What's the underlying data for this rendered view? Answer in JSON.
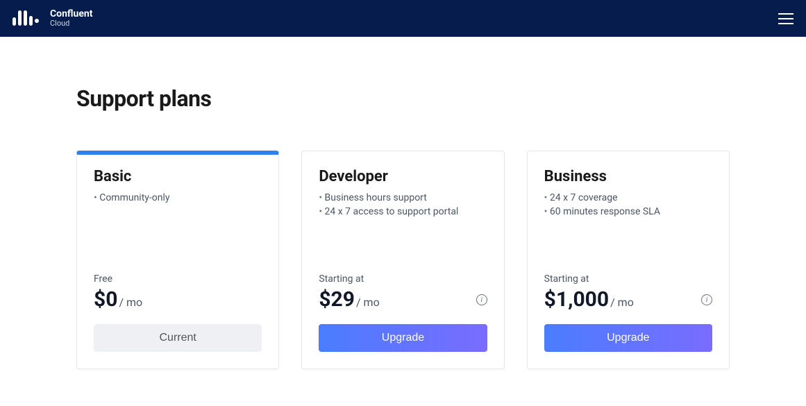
{
  "header": {
    "brand_name": "Confluent",
    "brand_sub": "Cloud"
  },
  "page": {
    "title": "Support plans"
  },
  "common": {
    "per_month": "/ mo"
  },
  "plans": [
    {
      "name": "Basic",
      "features": [
        "Community-only"
      ],
      "price_label": "Free",
      "price": "$0",
      "cta": "Current",
      "is_current": true,
      "show_info": false
    },
    {
      "name": "Developer",
      "features": [
        "Business hours support",
        "24 x 7 access to support portal"
      ],
      "price_label": "Starting at",
      "price": "$29",
      "cta": "Upgrade",
      "is_current": false,
      "show_info": true
    },
    {
      "name": "Business",
      "features": [
        "24 x 7 coverage",
        "60 minutes response SLA"
      ],
      "price_label": "Starting at",
      "price": "$1,000",
      "cta": "Upgrade",
      "is_current": false,
      "show_info": true
    }
  ]
}
